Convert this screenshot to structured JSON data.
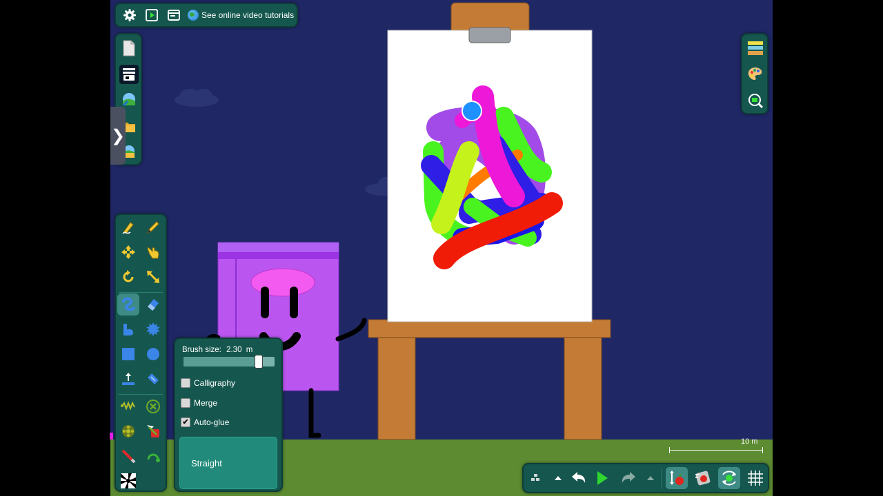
{
  "topbar": {
    "tutorials_label": "See online video tutorials"
  },
  "side_tab": {
    "chevron": "❯"
  },
  "brush": {
    "size_label": "Brush size:",
    "size_value": "2.30",
    "size_unit": "m",
    "slider_fraction": 0.86,
    "options": [
      {
        "label": "Calligraphy",
        "checked": false
      },
      {
        "label": "Merge",
        "checked": false
      },
      {
        "label": "Auto-glue",
        "checked": true
      }
    ],
    "straight_label": "Straight"
  },
  "scale": {
    "label": "10 m"
  },
  "colors": {
    "sky": "#1f2865",
    "ground": "#5c8b31",
    "panel": "#15574e",
    "easel_wood": "#c47b35",
    "block": "#bb55f0"
  }
}
